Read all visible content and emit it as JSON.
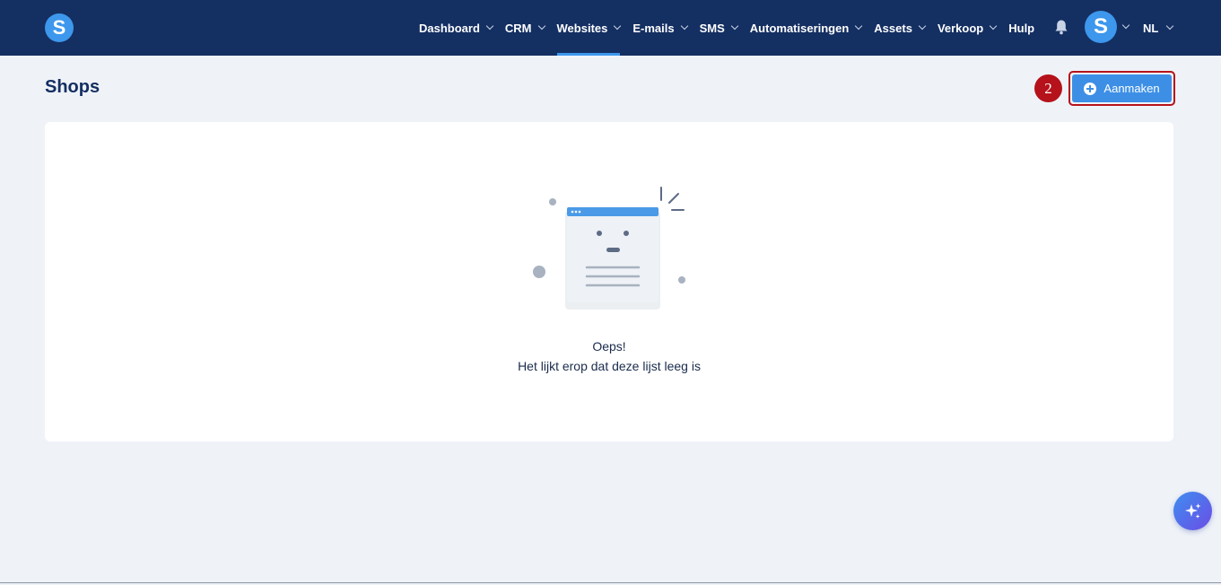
{
  "brand": {
    "logo_letter": "S",
    "accent": "#3d97ec",
    "nav_bg": "#142f62"
  },
  "nav": {
    "items": [
      {
        "label": "Dashboard",
        "dropdown": true,
        "active": false
      },
      {
        "label": "CRM",
        "dropdown": true,
        "active": false
      },
      {
        "label": "Websites",
        "dropdown": true,
        "active": true
      },
      {
        "label": "E-mails",
        "dropdown": true,
        "active": false
      },
      {
        "label": "SMS",
        "dropdown": true,
        "active": false
      },
      {
        "label": "Automatiseringen",
        "dropdown": true,
        "active": false
      },
      {
        "label": "Assets",
        "dropdown": true,
        "active": false
      },
      {
        "label": "Verkoop",
        "dropdown": true,
        "active": false
      },
      {
        "label": "Hulp",
        "dropdown": false,
        "active": false
      }
    ],
    "notifications_icon": "bell-icon",
    "avatar_letter": "S",
    "language": "NL"
  },
  "page": {
    "title": "Shops",
    "step_badge": "2",
    "create_button_label": "Aanmaken",
    "create_button_icon": "plus-circle-icon"
  },
  "empty_state": {
    "illustration": "empty-browser-window-illustration",
    "title": "Oeps!",
    "message": "Het lijkt erop dat deze lijst leeg is"
  },
  "fab": {
    "icon": "sparkles-icon"
  },
  "colors": {
    "button": "#3d8fe6",
    "highlight_border": "#b5121b",
    "page_bg": "#eff3f8"
  }
}
